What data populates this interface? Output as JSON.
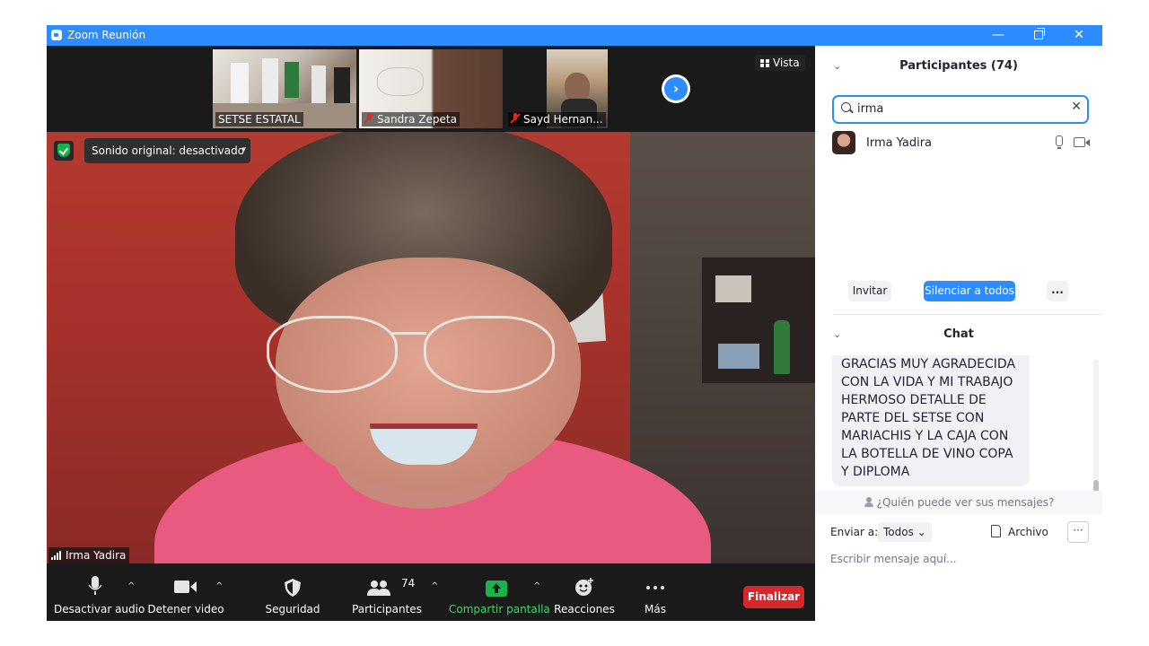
{
  "window": {
    "title": "Zoom Reunión",
    "controls": {
      "minimize": "—",
      "close": "✕"
    }
  },
  "gallery": {
    "thumbnails": [
      {
        "label": "SETSE ESTATAL",
        "muted": false
      },
      {
        "label": "Sandra Zepeta",
        "muted": true
      },
      {
        "label": "Sayd Hernan...",
        "muted": true
      }
    ],
    "next_arrow": "›",
    "view_label": "Vista"
  },
  "main_video": {
    "sound_button": "Sonido original: desactivado",
    "sound_chevron": "▾",
    "speaker_name": "Irma Yadira"
  },
  "toolbar": {
    "buttons": [
      {
        "label": "Desactivar audio",
        "icon": "mic-icon"
      },
      {
        "label": "Detener video",
        "icon": "video-icon"
      },
      {
        "label": "Seguridad",
        "icon": "shield-icon"
      },
      {
        "label": "Participantes",
        "icon": "participants-icon",
        "badge": "74"
      },
      {
        "label": "Compartir pantalla",
        "icon": "share-screen-icon"
      },
      {
        "label": "Reacciones",
        "icon": "reaction-icon"
      },
      {
        "label": "Más",
        "icon": "more-icon"
      }
    ],
    "caret": "^",
    "end_button": "Finalizar"
  },
  "participants_panel": {
    "title": "Participantes (74)",
    "collapse": "⌄",
    "search_value": "irma",
    "clear": "✕",
    "results": [
      {
        "name": "Irma Yadira"
      }
    ],
    "buttons": {
      "invite": "Invitar",
      "mute_all": "Silenciar a todos",
      "more": "..."
    }
  },
  "chat_panel": {
    "title": "Chat",
    "collapse": "⌄",
    "message": "GRACIAS MUY AGRADECIDA CON LA VIDA Y MI TRABAJO HERMOSO DETALLE DE PARTE DEL SETSE CON MARIACHIS Y LA CAJA CON LA BOTELLA DE VINO COPA Y DIPLOMA",
    "who_can_see": "¿Quién puede ver sus mensajes?",
    "send_to_label": "Enviar a:",
    "send_to_value": "Todos ⌄",
    "file_button": "Archivo",
    "more": "···",
    "input_placeholder": "Escribir mensaje aquí..."
  },
  "colors": {
    "zoom_blue": "#2d8cff",
    "end_red": "#d8262b",
    "share_green": "#19b34b",
    "toolbar_bg": "#1a1a1a"
  }
}
